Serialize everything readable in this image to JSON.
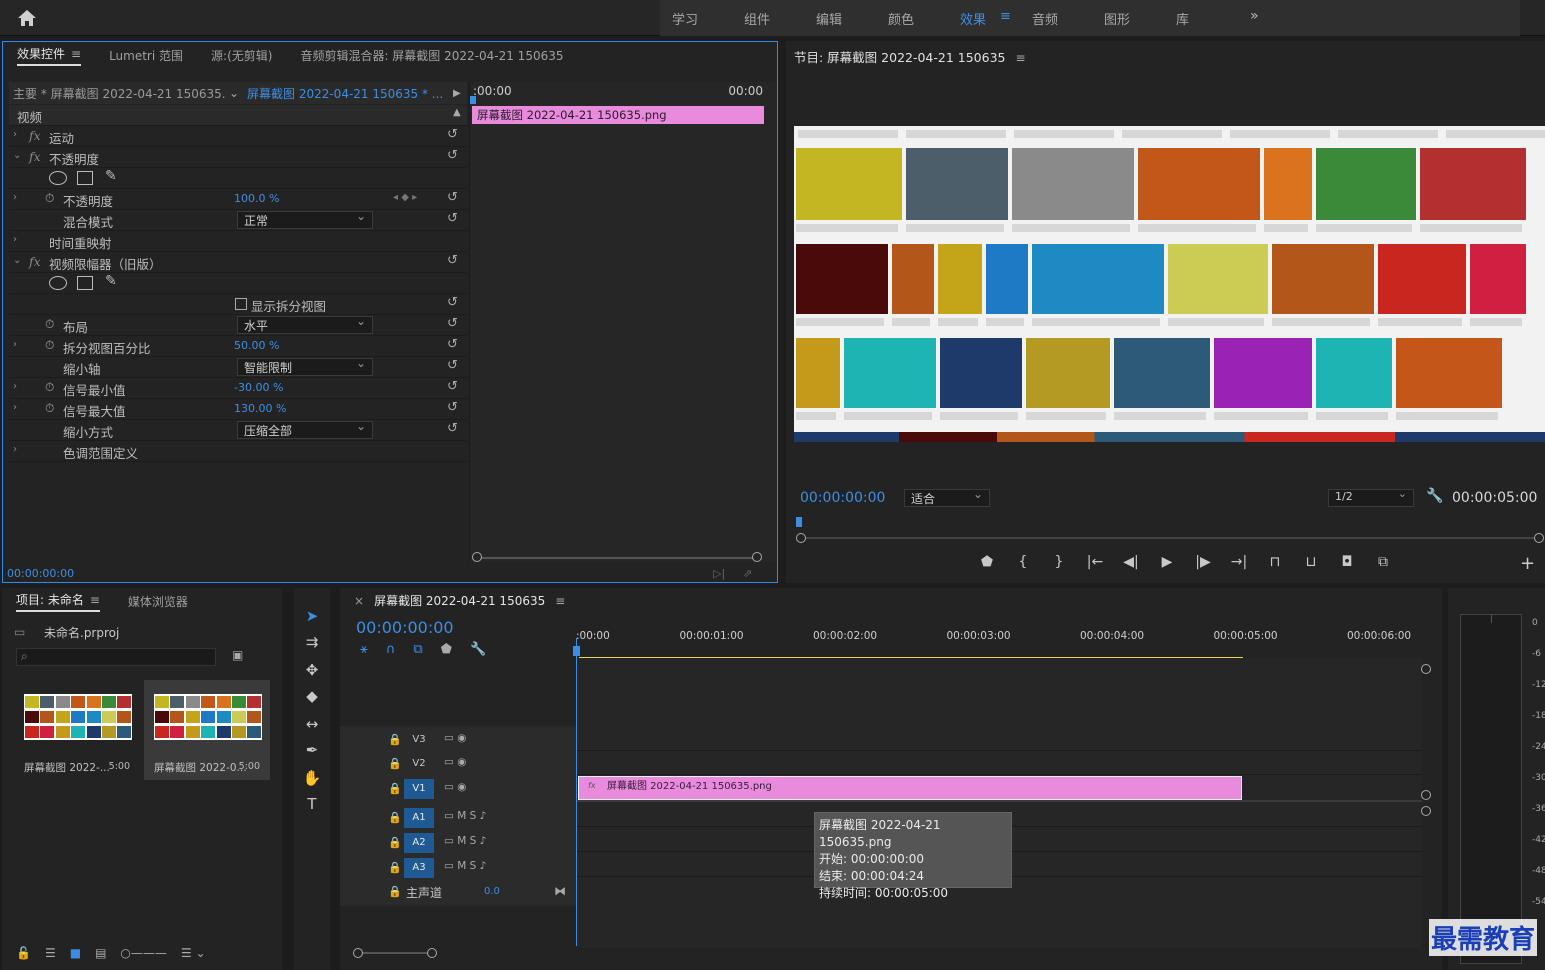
{
  "workspace": {
    "items": [
      "学习",
      "组件",
      "编辑",
      "颜色",
      "效果",
      "音频",
      "图形",
      "库"
    ],
    "active": "效果",
    "more": "»"
  },
  "effect_controls": {
    "tabs": [
      "效果控件",
      "Lumetri 范围",
      "源:(无剪辑)",
      "音频剪辑混合器: 屏幕截图 2022-04-21 150635"
    ],
    "active_tab": "效果控件",
    "source_left": "主要 * 屏幕截图 2022-04-21 150635...",
    "source_right": "屏幕截图 2022-04-21 150635 * ...",
    "video_header": "视频",
    "rows": [
      {
        "label": "运动",
        "fx": true,
        "indent": 0
      },
      {
        "label": "不透明度",
        "fx": true,
        "indent": 0,
        "open": true
      },
      {
        "label": "不透明度",
        "value": "100.0 %",
        "indent": 1,
        "stopwatch": true
      },
      {
        "label": "混合模式",
        "dropdown": "正常",
        "indent": 1
      },
      {
        "label": "时间重映射",
        "indent": 0
      },
      {
        "label": "视频限幅器（旧版）",
        "fx": true,
        "indent": 0,
        "open": true
      },
      {
        "label": "显示拆分视图",
        "checkbox": true,
        "indent": 2
      },
      {
        "label": "布局",
        "dropdown": "水平",
        "indent": 1,
        "stopwatch": true
      },
      {
        "label": "拆分视图百分比",
        "value": "50.00 %",
        "indent": 1,
        "stopwatch": true
      },
      {
        "label": "缩小轴",
        "dropdown": "智能限制",
        "indent": 1
      },
      {
        "label": "信号最小值",
        "value": "-30.00 %",
        "indent": 1,
        "stopwatch": true
      },
      {
        "label": "信号最大值",
        "value": "130.00 %",
        "indent": 1,
        "stopwatch": true
      },
      {
        "label": "缩小方式",
        "dropdown": "压缩全部",
        "indent": 1
      },
      {
        "label": "色调范围定义",
        "indent": 1
      }
    ],
    "tl_start": ":00:00",
    "tl_end": "00:00",
    "clip_label": "屏幕截图 2022-04-21  150635.png",
    "timecode": "00:00:00:00"
  },
  "program_monitor": {
    "title": "节目: 屏幕截图 2022-04-21 150635",
    "timecode": "00:00:00:00",
    "fit": "适合",
    "resolution": "1/2",
    "duration": "00:00:05:00",
    "transport_icons": [
      "marker-icon",
      "in-point-icon",
      "out-point-icon",
      "go-to-in-icon",
      "step-back-icon",
      "play-icon",
      "step-forward-icon",
      "go-to-out-icon",
      "lift-icon",
      "extract-icon",
      "camera-icon",
      "compare-icon"
    ],
    "thumb_colors": [
      "#c4b622",
      "#4d5e6b",
      "#8a8a8a",
      "#c2571a",
      "#d9731e",
      "#3a8a3a",
      "#b43030",
      "#4a0a0a",
      "#b3561a",
      "#c4a51a",
      "#1e7ac4",
      "#1e8ac4",
      "#cccc55",
      "#b3561a",
      "#c8261e",
      "#d02040",
      "#c49a1a",
      "#1eb4b4",
      "#1e3a6b",
      "#b49a22",
      "#2e5a7a",
      "#9a22b4",
      "#1eb4b4",
      "#c4561a"
    ]
  },
  "project": {
    "tabs": [
      "项目: 未命名",
      "媒体浏览器"
    ],
    "file": "未命名.prproj",
    "items": [
      {
        "label": "屏幕截图 2022-...",
        "duration": "5:00"
      },
      {
        "label": "屏幕截图 2022-0...",
        "duration": "5:00"
      }
    ]
  },
  "sequence": {
    "tab": "屏幕截图 2022-04-21 150635",
    "timecode": "00:00:00:00",
    "ticks": [
      ":00:00",
      "00:00:01:00",
      "00:00:02:00",
      "00:00:03:00",
      "00:00:04:00",
      "00:00:05:00",
      "00:00:06:00"
    ],
    "tracks": [
      {
        "name": "V3",
        "on": false,
        "icons": "▭  ◉"
      },
      {
        "name": "V2",
        "on": false,
        "icons": "▭  ◉"
      },
      {
        "name": "V1",
        "on": true,
        "icons": "▭  ◉"
      },
      {
        "name": "A1",
        "on": true,
        "icons": "▭   M    S    ♪"
      },
      {
        "name": "A2",
        "on": true,
        "icons": "▭   M    S    ♪"
      },
      {
        "name": "A3",
        "on": true,
        "icons": "▭   M    S    ♪"
      }
    ],
    "master": "主声道",
    "master_value": "0.0",
    "clip_label": "屏幕截图 2022-04-21  150635.png",
    "tooltip": {
      "name": "屏幕截图 2022-04-21 150635.png",
      "start": "开始: 00:00:00:00",
      "end": "结束: 00:00:04:24",
      "duration": "持续时间: 00:00:05:00"
    }
  },
  "meter": {
    "db_labels": [
      "0",
      "-6",
      "-12",
      "-18",
      "-24",
      "-30",
      "-36",
      "-42",
      "-48",
      "-54"
    ]
  },
  "watermark": "最需教育"
}
